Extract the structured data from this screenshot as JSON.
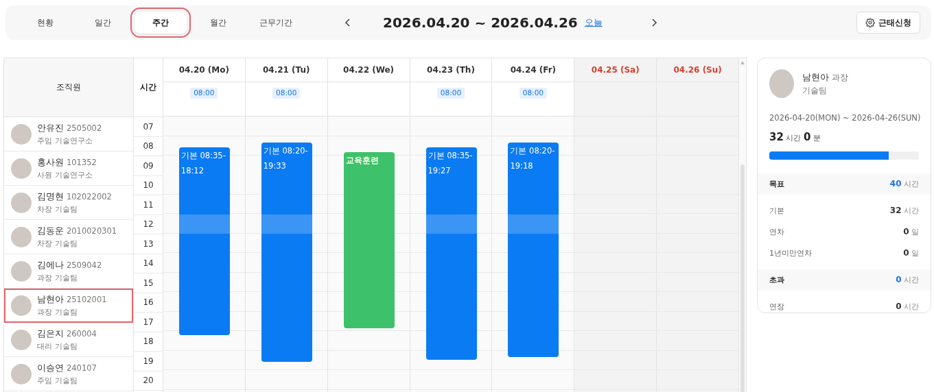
{
  "view_tabs": [
    {
      "label": "현황",
      "selected": false
    },
    {
      "label": "일간",
      "selected": false
    },
    {
      "label": "주간",
      "selected": true
    },
    {
      "label": "월간",
      "selected": false
    },
    {
      "label": "근무기간",
      "selected": false
    }
  ],
  "date_nav": {
    "range": "2026.04.20 ~ 2026.04.26",
    "today_link": "오늘"
  },
  "request_button": {
    "label": "근태신청"
  },
  "schedule": {
    "member_header": "조직원",
    "time_header": "시간",
    "hours": [
      "07",
      "08",
      "09",
      "10",
      "11",
      "12",
      "13",
      "14",
      "15",
      "16",
      "17",
      "18",
      "19",
      "20"
    ],
    "days": [
      {
        "label": "04.20 (Mo)",
        "weekend": false,
        "default_time": "08:00",
        "events": [
          {
            "kind": "work",
            "label": "기본 08:35-18:12"
          }
        ]
      },
      {
        "label": "04.21 (Tu)",
        "weekend": false,
        "default_time": "08:00",
        "events": [
          {
            "kind": "work",
            "label": "기본 08:20-19:33"
          }
        ]
      },
      {
        "label": "04.22 (We)",
        "weekend": false,
        "events": [
          {
            "kind": "training",
            "label": "교육훈련"
          }
        ]
      },
      {
        "label": "04.23 (Th)",
        "weekend": false,
        "default_time": "08:00",
        "events": [
          {
            "kind": "work",
            "label": "기본 08:35-19:27"
          }
        ]
      },
      {
        "label": "04.24 (Fr)",
        "weekend": false,
        "default_time": "08:00",
        "events": [
          {
            "kind": "work",
            "label": "기본 08:20-19:18"
          }
        ]
      },
      {
        "label": "04.25 (Sa)",
        "weekend": true
      },
      {
        "label": "04.26 (Su)",
        "weekend": true
      }
    ],
    "members": [
      {
        "name": "안유진",
        "employee_no": "2505002",
        "position": "주임",
        "department": "기술연구소",
        "selected": false
      },
      {
        "name": "홍사원",
        "employee_no": "101352",
        "position": "사원",
        "department": "기술연구소",
        "selected": false
      },
      {
        "name": "김명현",
        "employee_no": "102022002",
        "position": "차장",
        "department": "기술팀",
        "selected": false
      },
      {
        "name": "김동운",
        "employee_no": "2010020301",
        "position": "차장",
        "department": "기술팀",
        "selected": false
      },
      {
        "name": "김에나",
        "employee_no": "2509042",
        "position": "과장",
        "department": "기술팀",
        "selected": false
      },
      {
        "name": "남현아",
        "employee_no": "25102001",
        "position": "과장",
        "department": "기술팀",
        "selected": true
      },
      {
        "name": "김은지",
        "employee_no": "260004",
        "position": "대리",
        "department": "기술팀",
        "selected": false
      },
      {
        "name": "이승연",
        "employee_no": "240107",
        "position": "주임",
        "department": "기술팀",
        "selected": false
      }
    ]
  },
  "summary": {
    "name": "남현아",
    "position": "과장",
    "department": "기술팀",
    "period": "2026-04-20(MON) ~ 2026-04-26(SUN)",
    "total_hours": "32",
    "hours_unit": "시간",
    "total_minutes": "0",
    "minutes_unit": "분",
    "level": 0.8,
    "rows": [
      {
        "kind": "category",
        "label": "목표",
        "value": "40",
        "unit": "시간"
      },
      {
        "kind": "item",
        "label": "기본",
        "value": "32",
        "unit": "시간"
      },
      {
        "kind": "item",
        "label": "연차",
        "value": "0",
        "unit": "일"
      },
      {
        "kind": "item",
        "label": "1년미만연차",
        "value": "0",
        "unit": "일"
      },
      {
        "kind": "category",
        "label": "초과",
        "value": "0",
        "unit": "시간"
      },
      {
        "kind": "item",
        "label": "연장",
        "value": "0",
        "unit": "시간"
      }
    ]
  }
}
